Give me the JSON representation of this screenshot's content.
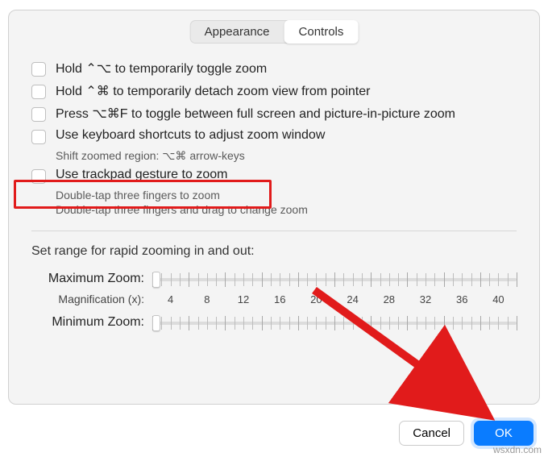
{
  "tabs": {
    "appearance": "Appearance",
    "controls": "Controls"
  },
  "options": {
    "hold_ctrl_opt": "Hold ⌃⌥ to temporarily toggle zoom",
    "hold_ctrl_cmd": "Hold ⌃⌘ to temporarily detach zoom view from pointer",
    "press_opt_cmd_f": "Press ⌥⌘F to toggle between full screen and picture-in-picture zoom",
    "keyboard_shortcuts": "Use keyboard shortcuts to adjust zoom window",
    "keyboard_shortcuts_hint": "Shift zoomed region:   ⌥⌘ arrow-keys",
    "trackpad": "Use trackpad gesture to zoom",
    "trackpad_hint1": "Double-tap three fingers to zoom",
    "trackpad_hint2": "Double-tap three fingers and drag to change zoom"
  },
  "range": {
    "title": "Set range for rapid zooming in and out:",
    "max_label": "Maximum Zoom:",
    "min_label": "Minimum Zoom:",
    "mag_label": "Magnification (x):",
    "mag_values": [
      "4",
      "8",
      "12",
      "16",
      "20",
      "24",
      "28",
      "32",
      "36",
      "40"
    ]
  },
  "buttons": {
    "cancel": "Cancel",
    "ok": "OK"
  },
  "watermark": "wsxdn.com",
  "colors": {
    "highlight": "#e11b1b",
    "primary": "#0a7cff"
  }
}
